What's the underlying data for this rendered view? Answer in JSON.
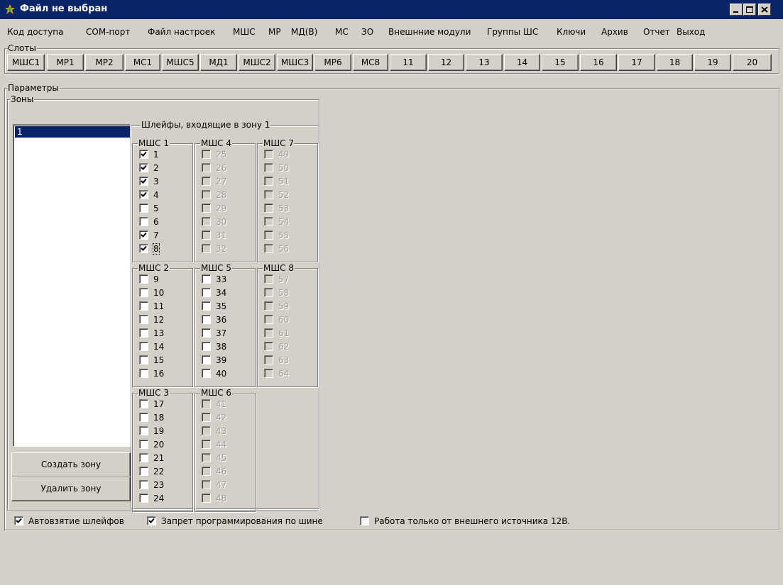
{
  "window": {
    "title": "Файл не выбран"
  },
  "menu": [
    "Код доступа",
    "COM-порт",
    "Файл настроек",
    "МШС",
    "МР",
    "МД(В)",
    "МС",
    "ЗО",
    "Внешнние модули",
    "Группы ШС",
    "Ключи",
    "Архив",
    "Отчет",
    "Выход"
  ],
  "slots": {
    "label": "Слоты",
    "items": [
      "МШС1",
      "МР1",
      "МР2",
      "МС1",
      "МШС5",
      "МД1",
      "МШС2",
      "МШС3",
      "МР6",
      "МС8",
      "11",
      "12",
      "13",
      "14",
      "15",
      "16",
      "17",
      "18",
      "19",
      "20"
    ]
  },
  "params": {
    "label": "Параметры"
  },
  "zones": {
    "label": "Зоны",
    "list": [
      "1"
    ],
    "create_label": "Создать зону",
    "delete_label": "Удалить зону"
  },
  "loops": {
    "label": "Шлейфы, входящие в зону 1",
    "groups": [
      {
        "name": "МШС 1",
        "start": 1,
        "enabled": true,
        "checked": [
          1,
          2,
          3,
          4,
          7,
          8
        ]
      },
      {
        "name": "МШС 4",
        "start": 25,
        "enabled": false,
        "checked": []
      },
      {
        "name": "МШС 7",
        "start": 49,
        "enabled": false,
        "checked": []
      },
      {
        "name": "МШС 2",
        "start": 9,
        "enabled": true,
        "checked": []
      },
      {
        "name": "МШС 5",
        "start": 33,
        "enabled": true,
        "checked": []
      },
      {
        "name": "МШС 8",
        "start": 57,
        "enabled": false,
        "checked": []
      },
      {
        "name": "МШС 3",
        "start": 17,
        "enabled": true,
        "checked": []
      },
      {
        "name": "МШС 6",
        "start": 41,
        "enabled": false,
        "checked": []
      }
    ]
  },
  "options": [
    {
      "label": "Автовзятие шлейфов",
      "checked": true
    },
    {
      "label": "Запрет программирования по шине",
      "checked": true
    },
    {
      "label": "Работа только от внешнего источника 12В.",
      "checked": false
    }
  ]
}
